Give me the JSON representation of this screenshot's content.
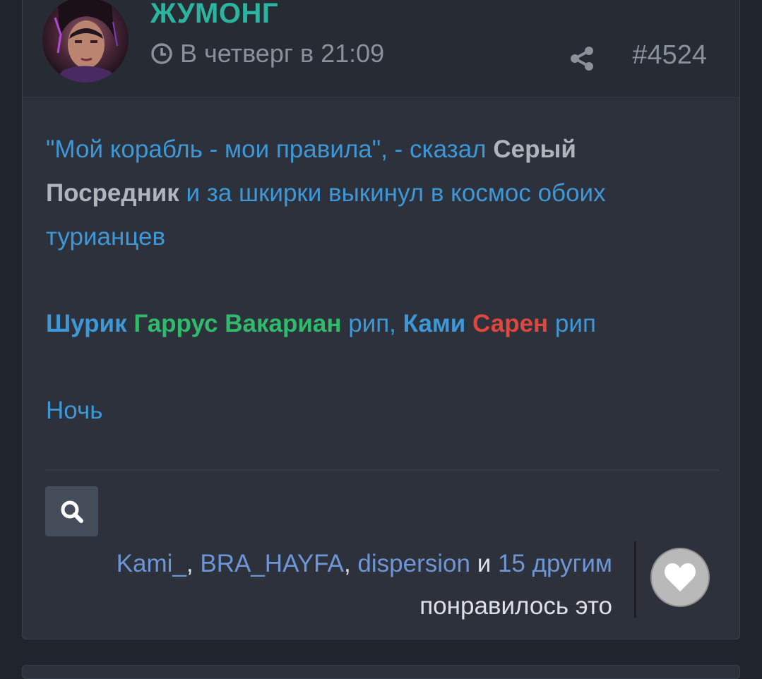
{
  "post": {
    "author": "ЖУМОНГ",
    "time": "В четверг в 21:09",
    "number": "#4524",
    "icons": {
      "clock": "clock-icon",
      "share": "share-icon",
      "search": "search-icon",
      "like": "heart-icon"
    },
    "content": {
      "quote": "\"Мой корабль - мои правила\", - сказал ",
      "speaker": "Серый Посредник",
      "rest": " и за шкирки выкинул в космос обоих турианцев",
      "line2_name1": "Шурик",
      "line2_name2": "Гаррус Вакариан",
      "line2_rip1": " рип, ",
      "line2_name3": "Ками",
      "line2_name4": "Сарен",
      "line2_rip2": " рип",
      "line3": "Ночь"
    },
    "reactions": {
      "users": [
        "Kami_",
        "BRA_HAYFA",
        "dispersion"
      ],
      "comma1": ", ",
      "comma2": ", ",
      "and": " и ",
      "others": "15 другим",
      "liked_text": "понравилось это"
    }
  },
  "colors": {
    "author": "#2bb5a0",
    "link_blue": "#3e97d6",
    "green": "#2fbb6b",
    "red": "#e0463b",
    "gray_bold": "#b0b4bb",
    "background": "#20242c",
    "card": "#2c313c"
  }
}
